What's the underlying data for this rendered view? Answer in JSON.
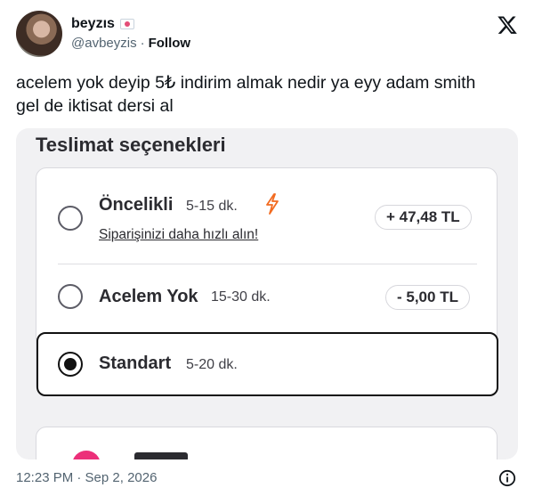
{
  "author": {
    "display_name": "beyzıs",
    "handle": "@avbeyzis",
    "separator": "·",
    "follow_label": "Follow"
  },
  "tweet": {
    "text_line1": "acelem yok deyip 5₺ indirim almak nedir ya eyy adam smith",
    "text_line2": "gel de iktisat dersi al"
  },
  "screenshot": {
    "title": "Teslimat seçenekleri",
    "options": [
      {
        "name": "Öncelikli",
        "time": "5-15 dk.",
        "price": "+ 47,48 TL",
        "link": "Siparişinizi daha hızlı alın!",
        "selected": false
      },
      {
        "name": "Acelem Yok",
        "time": "15-30 dk.",
        "price": "- 5,00 TL",
        "selected": false
      },
      {
        "name": "Standart",
        "time": "5-20 dk.",
        "selected": true
      }
    ]
  },
  "footer": {
    "timestamp": "12:23 PM · Sep 2, 2026"
  },
  "colors": {
    "lightning": "#f26b21",
    "accent_pink": "#ec2f79"
  },
  "icons": [
    "x-logo-icon",
    "lightning-icon",
    "info-icon",
    "flag-badge-icon"
  ]
}
